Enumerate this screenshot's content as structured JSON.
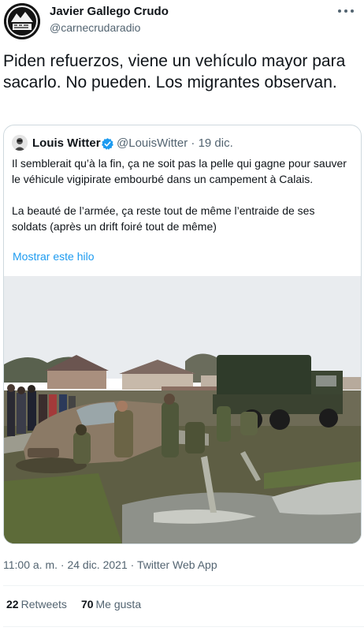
{
  "author": {
    "name": "Javier Gallego Crudo",
    "handle": "@carnecrudaradio"
  },
  "tweet": {
    "text": "Piden refuerzos, viene un vehículo mayor para sacarlo. No pueden. Los migrantes observan.",
    "timestamp": "11:00 a. m. · 24 dic. 2021",
    "client": "Twitter Web App",
    "separator": " · "
  },
  "quoted": {
    "name": "Louis Witter",
    "handle_date": "@LouisWitter · 19 dic.",
    "paragraph1": "Il semblerait qu’à la fin, ça ne soit pas la pelle qui gagne pour sauver le véhicule vigipirate embourbé dans un campement à Calais.",
    "paragraph2": "La beauté de l’armée, ça reste tout de même l’entraide de ses soldats (après un drift foiré tout de même)",
    "show_thread": "Mostrar este hilo"
  },
  "stats": {
    "retweets_count": "22",
    "retweets_label": "Retweets",
    "likes_count": "70",
    "likes_label": "Me gusta"
  },
  "icons": {
    "more": "more-horizontal-icon",
    "verified": "verified-badge-icon"
  },
  "colors": {
    "link": "#1d9bf0",
    "secondary_text": "#536471",
    "primary_text": "#0f1419",
    "border": "#cfd9de"
  }
}
